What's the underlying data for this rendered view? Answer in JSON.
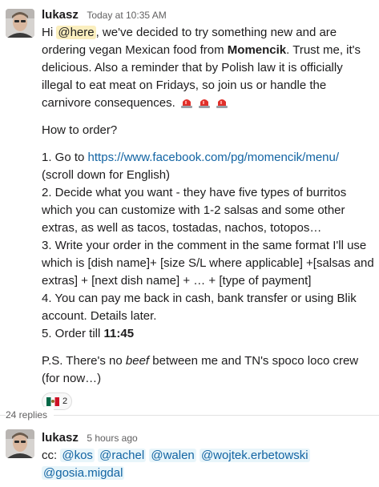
{
  "parent": {
    "author": "lukasz",
    "timestamp": "Today at 10:35 AM",
    "p1": {
      "hi": "Hi ",
      "mention": "@here",
      "t1": ", we've decided to try something new and are ordering vegan Mexican food from ",
      "bold": "Momencik",
      "t2": ". Trust me, it's delicious. Also a reminder that by Polish law it is officially illegal to eat meat on Fridays, so join us or handle the carnivore consequences.",
      "emoji": [
        "rotating-light",
        "rotating-light",
        "rotating-light"
      ]
    },
    "how": "How to order?",
    "step1_prefix": "1. Go to ",
    "step1_link": "https://www.facebook.com/pg/momencik/menu/",
    "step1_suffix": "(scroll down for English)",
    "step2": "2. Decide what you want - they have five types of burritos which you can customize with 1-2 salsas and some other extras, as well as tacos, tostadas, nachos, totopos…",
    "step3": "3. Write your order in the comment in the same format I'll use which is [dish name]+ [size S/L where applicable] +[salsas and extras] + [next dish name] + … + [type of payment]",
    "step4": "4. You can pay me back in cash, bank transfer or using Blik account. Details later.",
    "step5_prefix": "5. Order till ",
    "step5_time": "11:45",
    "ps_prefix": "P.S. There's no ",
    "ps_italic": "beef",
    "ps_suffix": " between me and TN's spoco loco crew (for now…)",
    "reaction": {
      "emoji": "flag-mexico",
      "count": "2"
    }
  },
  "replies_label": "24 replies",
  "reply": {
    "author": "lukasz",
    "timestamp": "5 hours ago",
    "cc": "cc: ",
    "mentions": [
      "@kos",
      "@rachel",
      "@walen",
      "@wojtek.erbetowski",
      "@gosia.migdal"
    ]
  },
  "colors": {
    "link": "#1264a3",
    "mention_bg": "#e8f5fa",
    "here_bg": "#fbefbf",
    "text": "#1d1c1d",
    "muted": "#616061"
  }
}
